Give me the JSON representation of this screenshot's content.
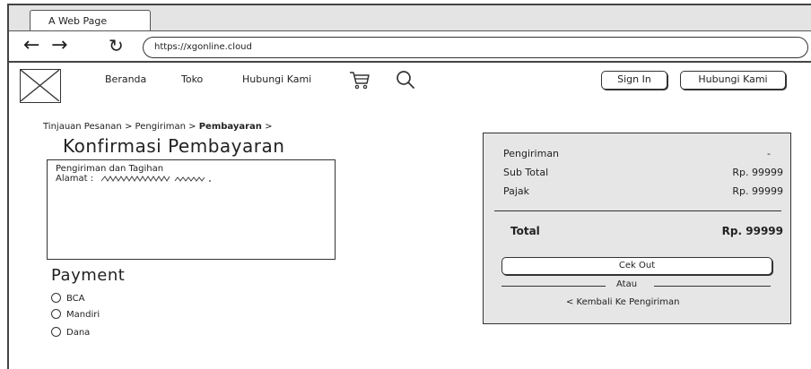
{
  "browser": {
    "tab_title": "A Web Page",
    "back_glyph": "←",
    "forward_glyph": "→",
    "reload_glyph": "↻",
    "url": "https://xgonline.cloud"
  },
  "header": {
    "logo_icon": "image-placeholder-icon",
    "nav": [
      "Beranda",
      "Toko",
      "Hubungi Kami"
    ],
    "cart_icon": "cart-icon",
    "search_icon": "search-icon",
    "sign_in_label": "Sign In",
    "contact_label": "Hubungi Kami"
  },
  "breadcrumb": {
    "items": [
      "Tinjauan Pesanan",
      "Pengiriman",
      "Pembayaran"
    ],
    "separator": ">"
  },
  "page_title": "Konfirmasi Pembayaran",
  "info_box": {
    "heading": "Pengiriman dan Tagihan",
    "address_label": "Alamat :"
  },
  "payment": {
    "title": "Payment",
    "options": [
      "BCA",
      "Mandiri",
      "Dana"
    ]
  },
  "summary": {
    "rows": [
      {
        "label": "Pengiriman",
        "value": "-"
      },
      {
        "label": "Sub Total",
        "value": "Rp. 99999"
      },
      {
        "label": "Pajak",
        "value": "Rp. 99999"
      }
    ],
    "total_label": "Total",
    "total_value": "Rp. 99999",
    "checkout_label": "Cek Out",
    "or_label": "Atau",
    "back_label": "< Kembali Ke Pengiriman"
  }
}
